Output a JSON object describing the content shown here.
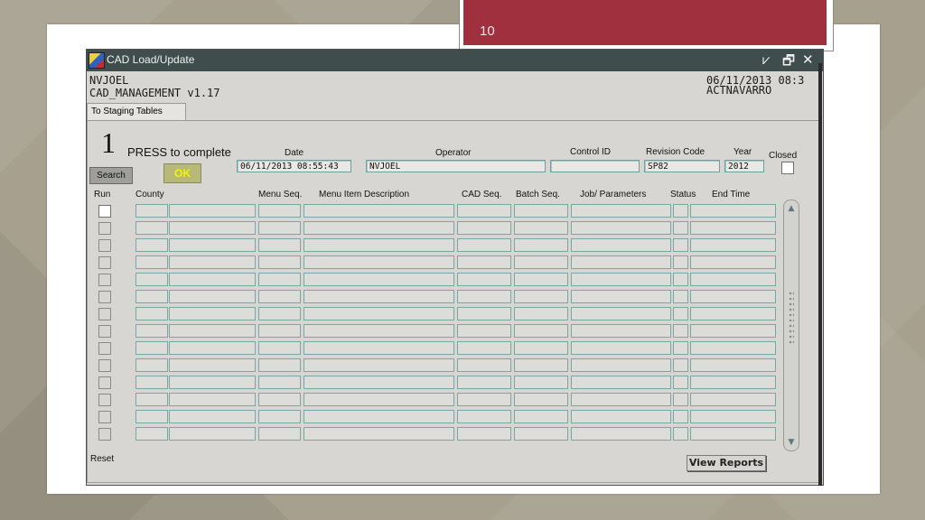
{
  "slide": {
    "number": "10"
  },
  "window": {
    "title": "CAD Load/Update",
    "controls": [
      "⩗",
      "🗗",
      "✕"
    ]
  },
  "header": {
    "user": "NVJOEL",
    "app_version": "CAD_MANAGEMENT v1.17",
    "datetime": "06/11/2013 08:3",
    "login_user": "ACTNAVARRO"
  },
  "tab": {
    "label": "To Staging Tables"
  },
  "step": {
    "number": "1",
    "instruction": "PRESS to complete"
  },
  "buttons": {
    "search": "Search",
    "ok": "OK",
    "reset": "Reset",
    "view_reports": "View Reports"
  },
  "fields": {
    "date": {
      "label": "Date",
      "value": "06/11/2013 08:55:43"
    },
    "operator": {
      "label": "Operator",
      "value": "NVJOEL"
    },
    "control_id": {
      "label": "Control ID",
      "value": ""
    },
    "revision_code": {
      "label": "Revision  Code",
      "value": "SP82"
    },
    "year": {
      "label": "Year",
      "value": "2012"
    },
    "closed": {
      "label": "Closed",
      "checked": false
    }
  },
  "table": {
    "columns": [
      "Run",
      "County",
      "Menu Seq.",
      "Menu Item Description",
      "CAD Seq.",
      "Batch Seq.",
      "Job/ Parameters",
      "Status",
      "End Time"
    ],
    "row_count": 14
  },
  "colors": {
    "titlebar": "#3f4e4d",
    "slide_accent": "#a0303d",
    "field_border": "#6fa0a0",
    "ok_text": "#f4f400"
  }
}
